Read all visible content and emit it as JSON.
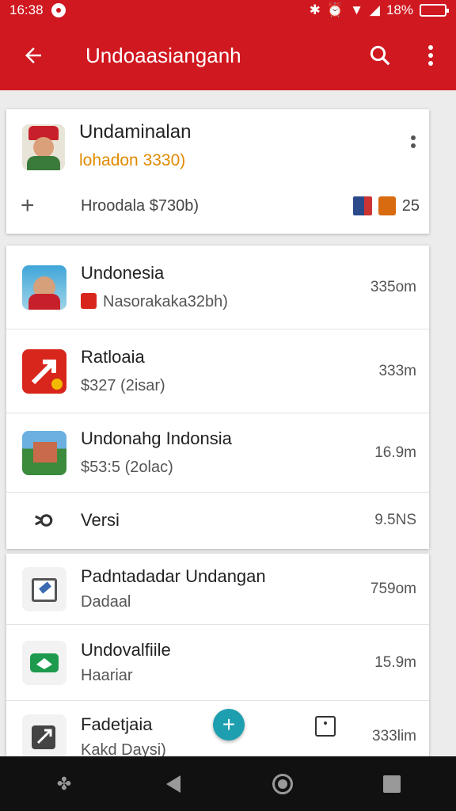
{
  "status_bar": {
    "time": "16:38",
    "battery": "18%"
  },
  "app_bar": {
    "title": "Undoaasianganh",
    "back_icon": "arrow-left-icon",
    "search_icon": "search-icon",
    "menu_icon": "more-vert-icon"
  },
  "profile_card": {
    "name": "Undaminalan",
    "subtitle": "lohadon 3330)",
    "info": "Hroodala $730b)",
    "count": "25",
    "accent_color": "#e08a00"
  },
  "list_primary": [
    {
      "title": "Undonesia",
      "subtitle": "Nasorakaka32bh)",
      "meta": "335om"
    },
    {
      "title": "Ratloaia",
      "subtitle": "$327  (2isar)",
      "meta": "333m"
    },
    {
      "title": "Undonahg Indonsia",
      "subtitle": "$53:5  (2olac)",
      "meta": "16.9m"
    },
    {
      "title": "Versi",
      "meta": "9.5NS"
    }
  ],
  "list_secondary": [
    {
      "title": "Padntadadar Undangan",
      "subtitle": "Dadaal",
      "meta": "759om"
    },
    {
      "title": "Undovalfiile",
      "subtitle": "Haariar",
      "meta": "15.9m"
    },
    {
      "title": "Fadetjaia",
      "subtitle": "Kakd Daysi)",
      "meta": "333lim"
    }
  ],
  "colors": {
    "appbar": "#d01820",
    "fab": "#1e9fb0"
  }
}
